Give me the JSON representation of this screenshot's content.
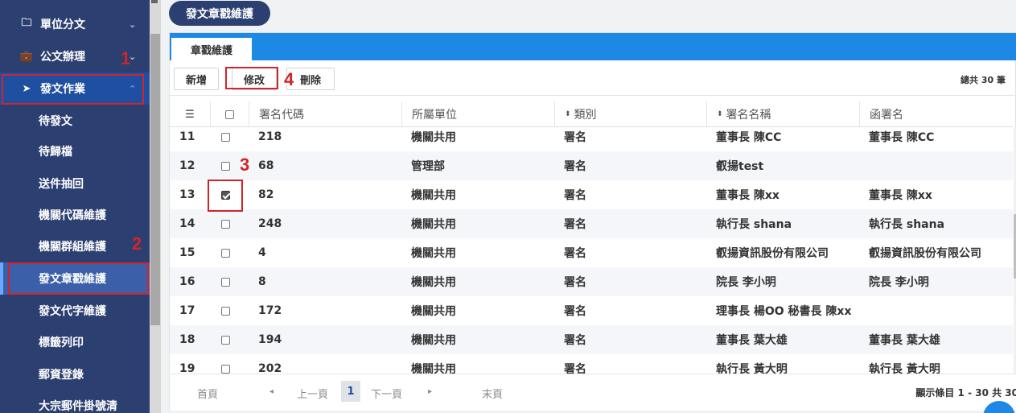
{
  "page": {
    "title": "發文章戳維護"
  },
  "sidebar": {
    "items": [
      {
        "label": "單位分文",
        "icon": "folder-icon",
        "level": "top",
        "chevron": "⌄"
      },
      {
        "label": "公文辦理",
        "icon": "briefcase-icon",
        "level": "top",
        "chevron": "⌄"
      },
      {
        "label": "發文作業",
        "icon": "paper-plane-icon",
        "level": "top",
        "chevron": "⌃",
        "state": "expanded"
      },
      {
        "label": "待發文",
        "level": "sub"
      },
      {
        "label": "待歸檔",
        "level": "sub"
      },
      {
        "label": "送件抽回",
        "level": "sub"
      },
      {
        "label": "機關代碼維護",
        "level": "sub"
      },
      {
        "label": "機關群組維護",
        "level": "sub"
      },
      {
        "label": "發文章戳維護",
        "level": "sub",
        "state": "active"
      },
      {
        "label": "發文代字維護",
        "level": "sub"
      },
      {
        "label": "標籤列印",
        "level": "sub"
      },
      {
        "label": "郵資登錄",
        "level": "sub"
      },
      {
        "label": "大宗郵件掛號清",
        "level": "sub"
      }
    ]
  },
  "tabs": [
    {
      "label": "章戳維護",
      "active": true
    }
  ],
  "toolbar": {
    "add_label": "新增",
    "edit_label": "修改",
    "delete_label": "刪除",
    "total_label": "總共 30 筆"
  },
  "table": {
    "columns": [
      "",
      "",
      "署名代碼",
      "所屬單位",
      "類別",
      "署名名稱",
      "函署名"
    ],
    "sortable_icon": "⬍",
    "rows": [
      {
        "no": "11",
        "checked": false,
        "code": "218",
        "unit": "機關共用",
        "type": "署名",
        "name": "董事長 陳CC",
        "sign": "董事長 陳CC"
      },
      {
        "no": "12",
        "checked": false,
        "code": "68",
        "unit": "管理部",
        "type": "署名",
        "name": "叡揚test",
        "sign": ""
      },
      {
        "no": "13",
        "checked": true,
        "code": "82",
        "unit": "機關共用",
        "type": "署名",
        "name": "董事長 陳xx",
        "sign": "董事長 陳xx"
      },
      {
        "no": "14",
        "checked": false,
        "code": "248",
        "unit": "機關共用",
        "type": "署名",
        "name": "執行長 shana",
        "sign": "執行長 shana"
      },
      {
        "no": "15",
        "checked": false,
        "code": "4",
        "unit": "機關共用",
        "type": "署名",
        "name": "叡揚資訊股份有限公司",
        "sign": "叡揚資訊股份有限公司"
      },
      {
        "no": "16",
        "checked": false,
        "code": "8",
        "unit": "機關共用",
        "type": "署名",
        "name": "院長 李小明",
        "sign": "院長 李小明"
      },
      {
        "no": "17",
        "checked": false,
        "code": "172",
        "unit": "機關共用",
        "type": "署名",
        "name": "理事長 楊OO 秘書長 陳xx",
        "sign": ""
      },
      {
        "no": "18",
        "checked": false,
        "code": "194",
        "unit": "機關共用",
        "type": "署名",
        "name": "董事長 葉大雄",
        "sign": "董事長 葉大雄"
      },
      {
        "no": "19",
        "checked": false,
        "code": "202",
        "unit": "機關共用",
        "type": "署名",
        "name": "執行長 黃大明",
        "sign": "執行長 黃大明"
      }
    ]
  },
  "pager": {
    "first": "首頁",
    "prev_arrow": "◂",
    "prev": "上一頁",
    "current": "1",
    "next": "下一頁",
    "next_arrow": "▸",
    "last": "末頁",
    "info": "顯示條目 1 - 30 共 30"
  },
  "annotations": [
    "1",
    "2",
    "3",
    "4"
  ],
  "colors": {
    "sidebar": "#2b3f70",
    "accent": "#1e88e5",
    "annotation": "#d0252a"
  }
}
